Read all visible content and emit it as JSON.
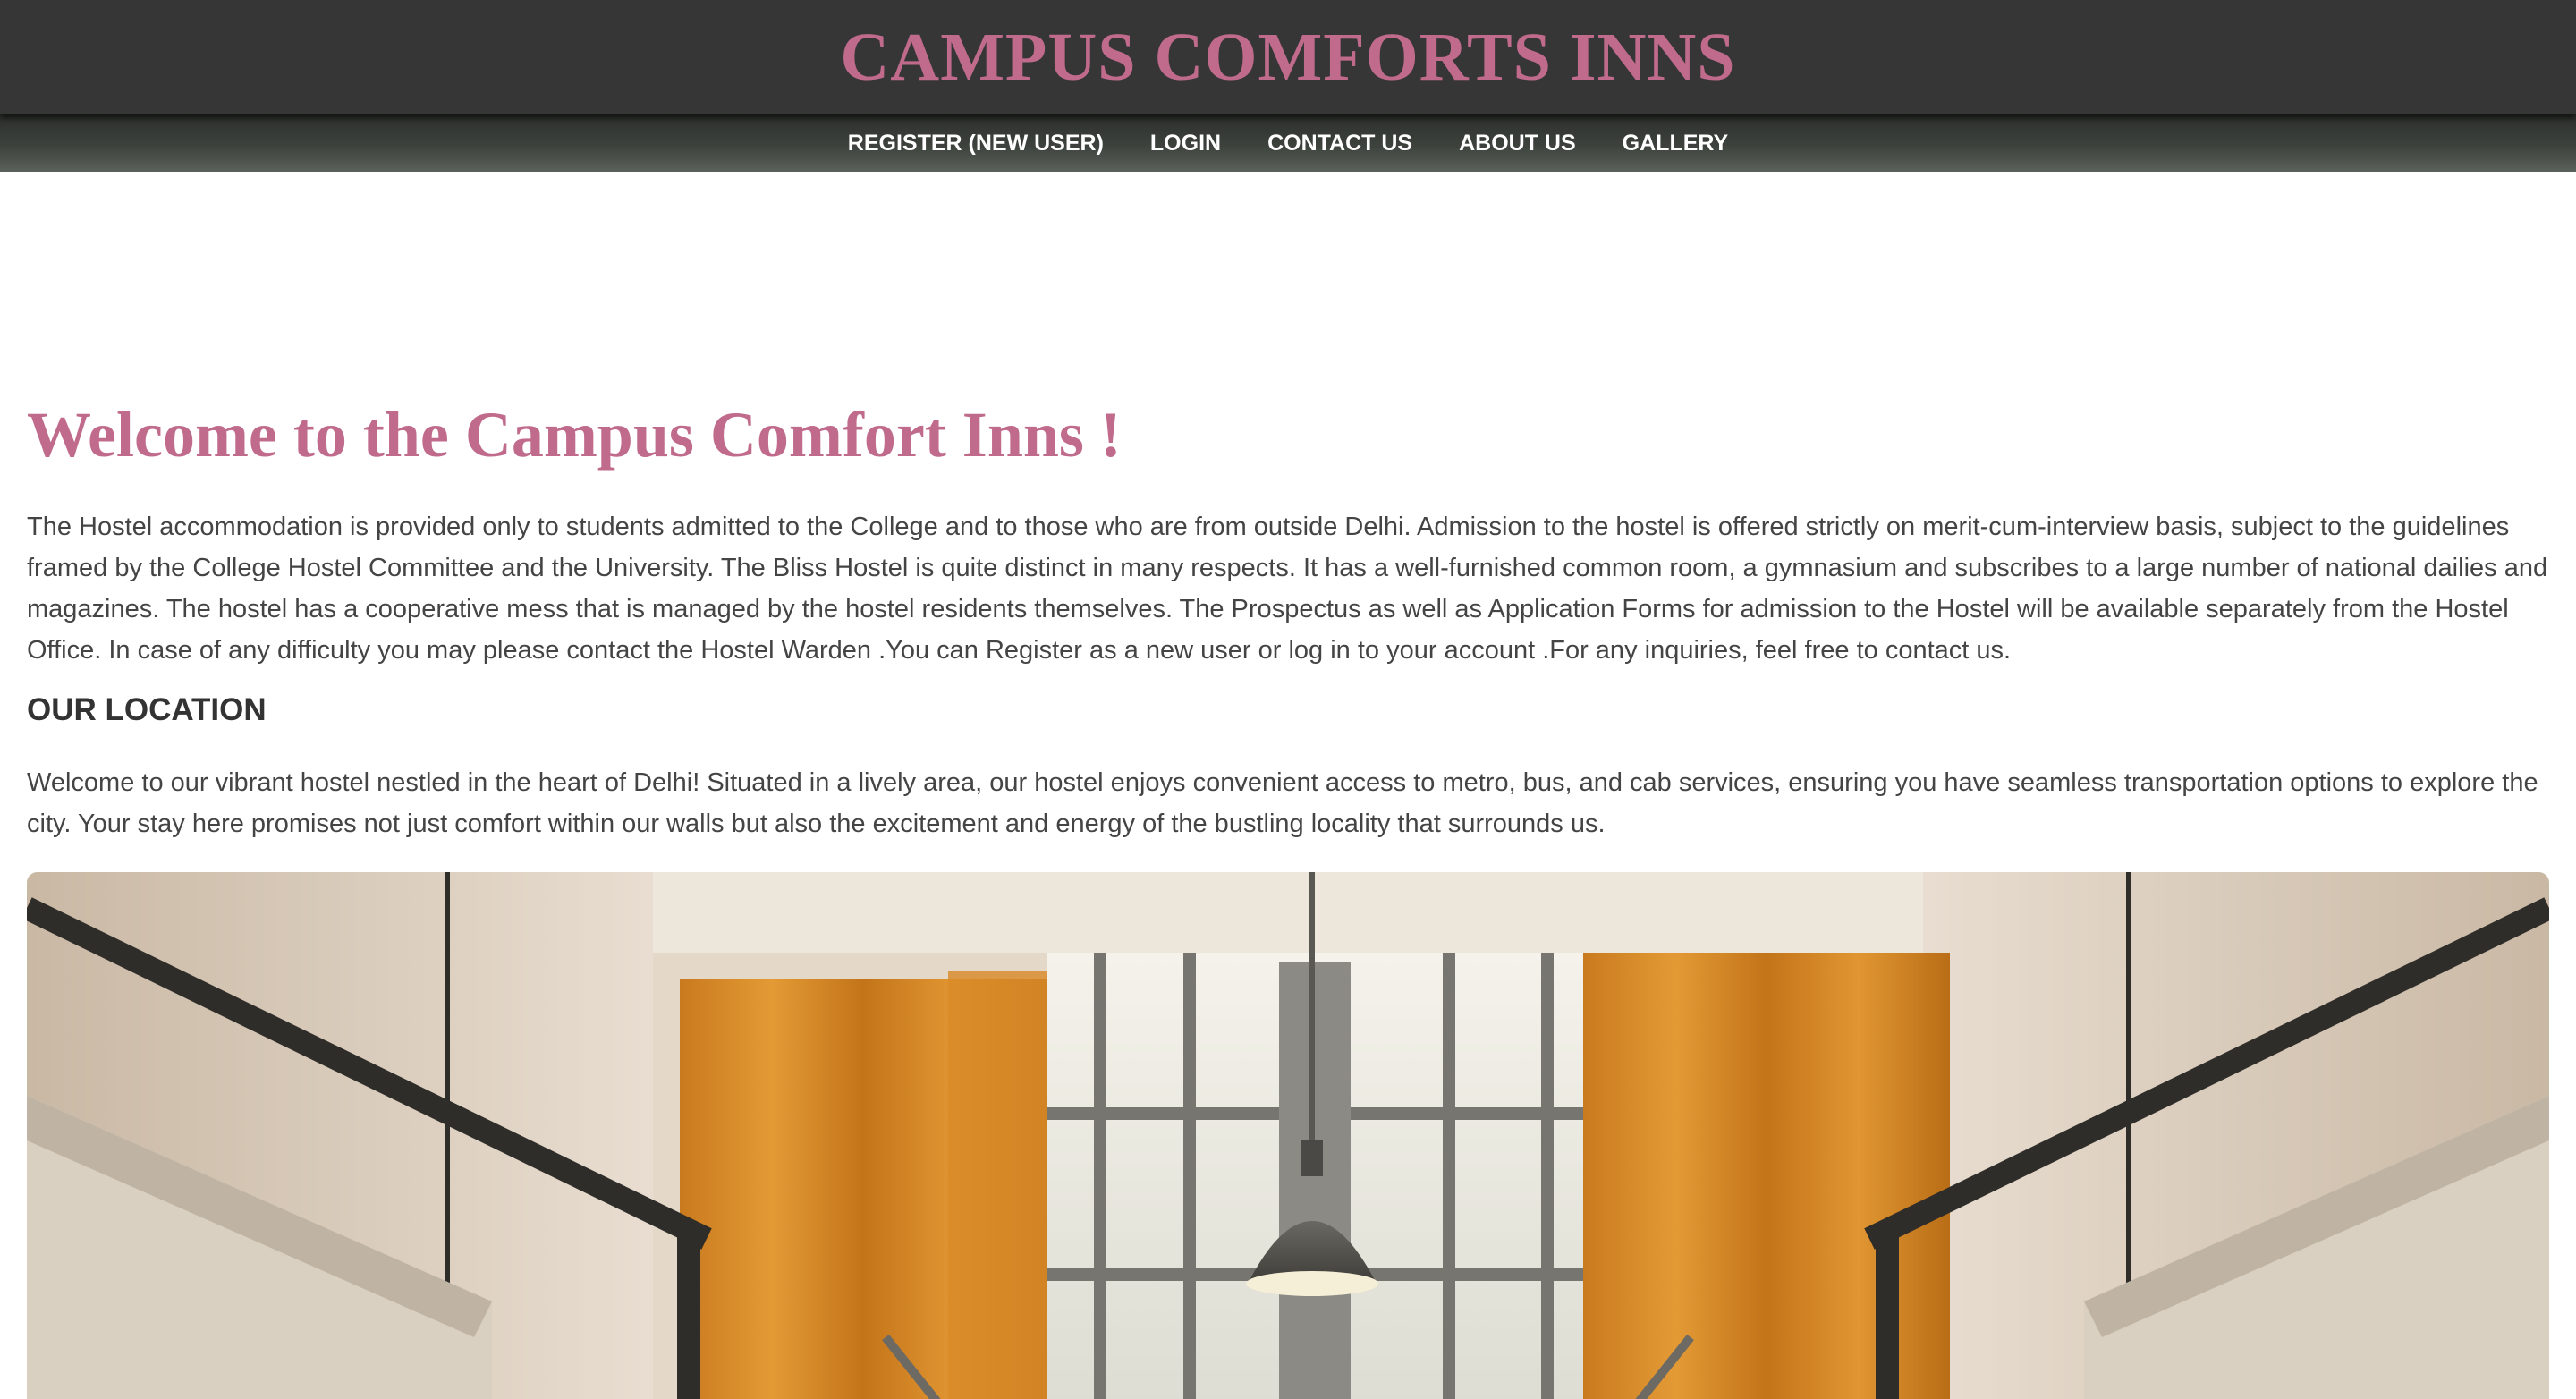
{
  "header": {
    "title": "CAMPUS COMFORTS INNS"
  },
  "nav": {
    "items": [
      {
        "label": "REGISTER (NEW USER)"
      },
      {
        "label": "LOGIN"
      },
      {
        "label": "CONTACT US"
      },
      {
        "label": "ABOUT US"
      },
      {
        "label": "GALLERY"
      }
    ]
  },
  "main": {
    "welcome_heading": "Welcome to the Campus Comfort Inns !",
    "intro_text": "The Hostel accommodation is provided only to students admitted to the College and to those who are from outside Delhi. Admission to the hostel is offered strictly on merit-cum-interview basis, subject to the guidelines framed by the College Hostel Committee and the University. The Bliss Hostel is quite distinct in many respects. It has a well-furnished common room, a gymnasium and subscribes to a large number of national dailies and magazines. The hostel has a cooperative mess that is managed by the hostel residents themselves. The Prospectus as well as Application Forms for admission to the Hostel will be available separately from the Hostel Office. In case of any difficulty you may please contact the Hostel Warden .You can Register as a new user or log in to your account .For any inquiries, feel free to contact us.",
    "location_heading": "OUR LOCATION",
    "location_text": "Welcome to our vibrant hostel nestled in the heart of Delhi! Situated in a lively area, our hostel enjoys convenient access to metro, bus, and cab services, ensuring you have seamless transportation options to explore the city. Your stay here promises not just comfort within our walls but also the excitement and energy of the bustling locality that surrounds us."
  },
  "colors": {
    "header_bg": "#363636",
    "title_pink": "#c06b8c",
    "nav_text": "#ffffff",
    "body_text": "#444444"
  }
}
